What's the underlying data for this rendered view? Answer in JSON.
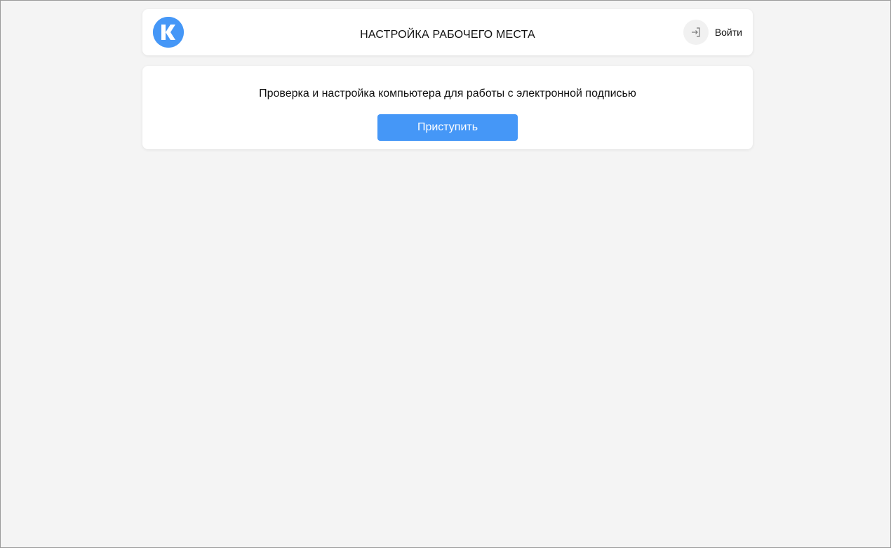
{
  "header": {
    "title": "НАСТРОЙКА РАБОЧЕГО МЕСТА",
    "logo_icon": "k-logo-icon",
    "login_icon": "login-arrow-icon",
    "login_label": "Войти"
  },
  "main": {
    "description": "Проверка и настройка компьютера для работы с электронной подписью",
    "start_button_label": "Приступить"
  },
  "colors": {
    "accent": "#4597f7",
    "background": "#f4f4f4",
    "card": "#ffffff"
  }
}
